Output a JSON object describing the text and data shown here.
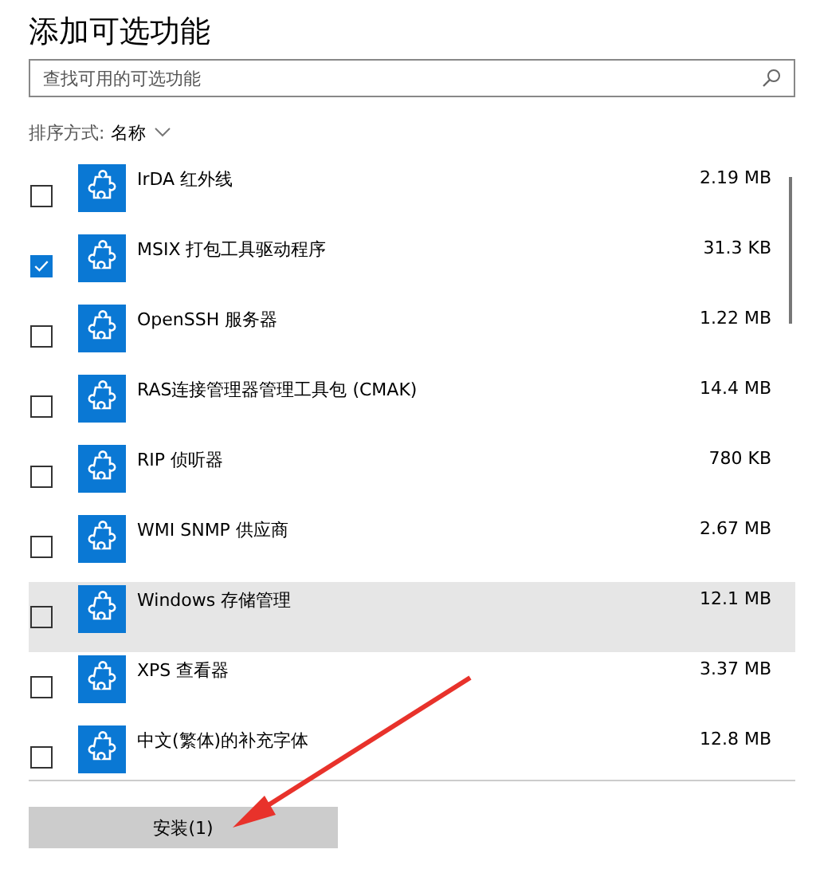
{
  "window": {
    "title": "添加可选功能"
  },
  "search": {
    "placeholder": "查找可用的可选功能"
  },
  "sort": {
    "label": "排序方式:",
    "value": "名称"
  },
  "features": [
    {
      "name": "IrDA 红外线",
      "size": "2.19 MB",
      "checked": false,
      "highlighted": false
    },
    {
      "name": "MSIX 打包工具驱动程序",
      "size": "31.3 KB",
      "checked": true,
      "highlighted": false
    },
    {
      "name": "OpenSSH 服务器",
      "size": "1.22 MB",
      "checked": false,
      "highlighted": false
    },
    {
      "name": "RAS连接管理器管理工具包 (CMAK)",
      "size": "14.4 MB",
      "checked": false,
      "highlighted": false
    },
    {
      "name": "RIP 侦听器",
      "size": "780 KB",
      "checked": false,
      "highlighted": false
    },
    {
      "name": "WMI SNMP 供应商",
      "size": "2.67 MB",
      "checked": false,
      "highlighted": false
    },
    {
      "name": "Windows 存储管理",
      "size": "12.1 MB",
      "checked": false,
      "highlighted": true
    },
    {
      "name": "XPS 查看器",
      "size": "3.37 MB",
      "checked": false,
      "highlighted": false
    },
    {
      "name": "中文(繁体)的补充字体",
      "size": "12.8 MB",
      "checked": false,
      "highlighted": false
    }
  ],
  "install_button": {
    "label": "安装(1)"
  }
}
